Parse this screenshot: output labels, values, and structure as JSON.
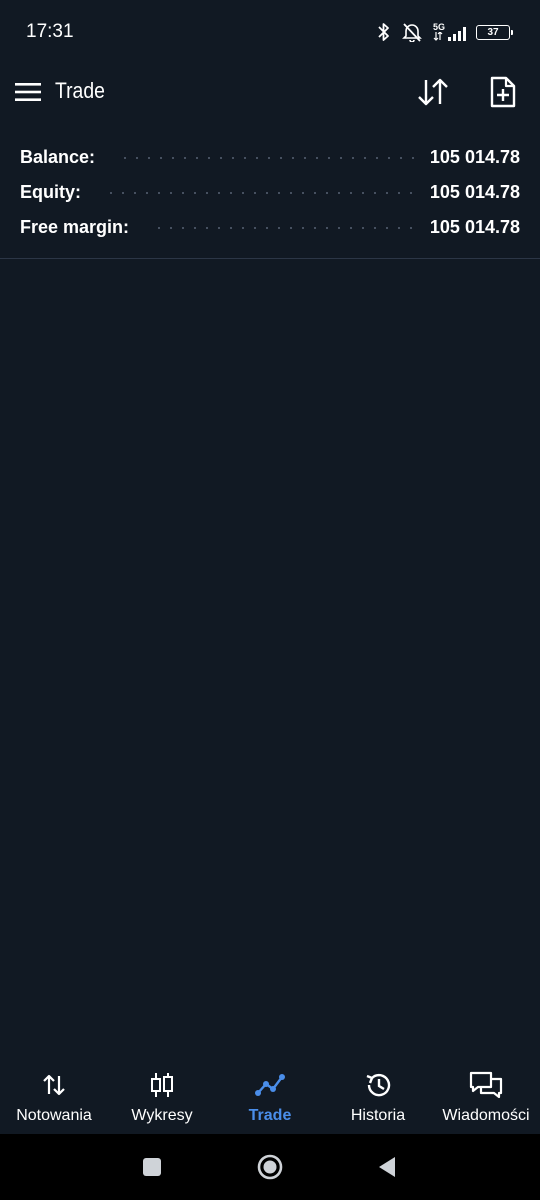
{
  "status_bar": {
    "time": "17:31",
    "network": "5G",
    "battery": "37",
    "icons": [
      "bluetooth-icon",
      "bell-off-icon",
      "signal-icon",
      "battery-icon"
    ]
  },
  "header": {
    "title": "Trade",
    "icons": [
      "menu-icon",
      "sort-icon",
      "new-order-icon"
    ]
  },
  "account": {
    "rows": [
      {
        "label": "Balance:",
        "value": "105 014.78"
      },
      {
        "label": "Equity:",
        "value": "105 014.78"
      },
      {
        "label": "Free margin:",
        "value": "105 014.78"
      }
    ]
  },
  "bottom_nav": {
    "items": [
      {
        "label": "Notowania",
        "icon": "quotes-icon",
        "active": false
      },
      {
        "label": "Wykresy",
        "icon": "candlestick-icon",
        "active": false
      },
      {
        "label": "Trade",
        "icon": "trade-icon",
        "active": true
      },
      {
        "label": "Historia",
        "icon": "history-icon",
        "active": false
      },
      {
        "label": "Wiadomości",
        "icon": "messages-icon",
        "active": false
      }
    ]
  },
  "system_nav": {
    "icons": [
      "recents-icon",
      "home-icon",
      "back-icon"
    ]
  },
  "colors": {
    "background": "#111923",
    "accent": "#4a8eea",
    "text": "#ffffff",
    "divider": "#2c3646"
  }
}
